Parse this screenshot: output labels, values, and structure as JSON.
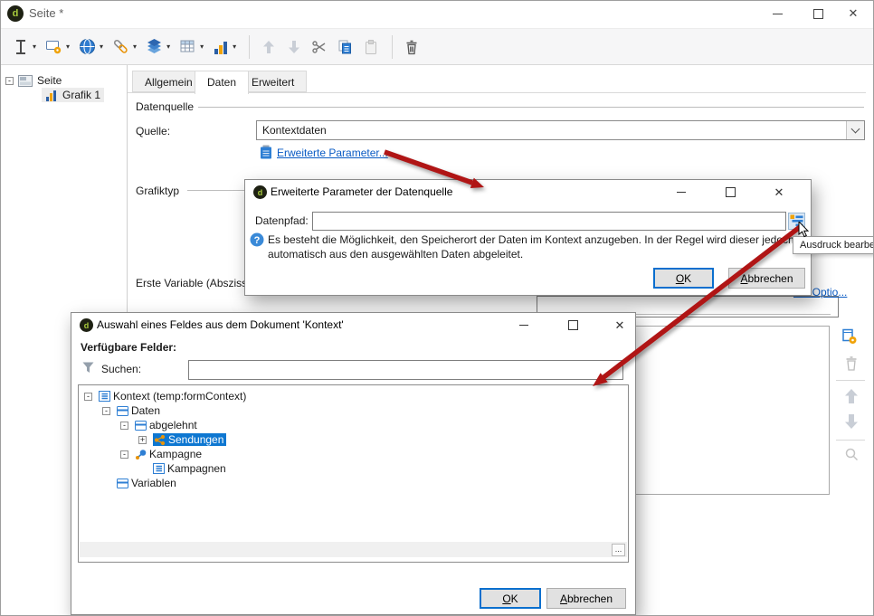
{
  "window": {
    "title": "Seite *"
  },
  "left_tree": {
    "root_label": "Seite",
    "child_label": "Grafik 1"
  },
  "tabs": {
    "allgemein": "Allgemein",
    "daten": "Daten",
    "erweitert": "Erweitert"
  },
  "content": {
    "datenquelle_group": "Datenquelle",
    "quelle_label": "Quelle:",
    "quelle_value": "Kontextdaten",
    "erweiterte_parameter_link": "Erweiterte Parameter...",
    "grafiktyp_group": "Grafiktyp",
    "erste_variable_label": "Erste Variable (Abszisse",
    "weitere_optionen_link_fragment": "ere Optio..."
  },
  "dialog1": {
    "title": "Erweiterte Parameter der Datenquelle",
    "datenpfad_label": "Datenpfad:",
    "datenpfad_value": "",
    "info_text": "Es besteht die Möglichkeit, den Speicherort der Daten im Kontext anzugeben. In der Regel wird dieser jedoch automatisch aus den ausgewählten Daten abgeleitet.",
    "ok_underlined": "O",
    "ok_rest": "K",
    "cancel_underlined": "A",
    "cancel_rest": "bbrechen",
    "tooltip": "Ausdruck bearbeiten"
  },
  "dialog2": {
    "title": "Auswahl eines Feldes aus dem Dokument 'Kontext'",
    "available_fields_label": "Verfügbare Felder:",
    "search_label": "Suchen:",
    "search_value": "",
    "tree": [
      {
        "label": "Kontext (temp:formContext)",
        "exp": "-"
      },
      {
        "label": "Daten",
        "exp": "-"
      },
      {
        "label": "abgelehnt",
        "exp": "-"
      },
      {
        "label": "Sendungen",
        "exp": "+"
      },
      {
        "label": "Kampagne",
        "exp": "-"
      },
      {
        "label": "Kampagnen",
        "exp": ""
      },
      {
        "label": "Variablen",
        "exp": ""
      }
    ],
    "overflow_button": "...",
    "ok_underlined": "O",
    "ok_rest": "K",
    "cancel_underlined": "A",
    "cancel_rest": "bbrechen"
  },
  "colors": {
    "accent_blue": "#0e77d1",
    "link_blue": "#0a5bc4",
    "icon_blue": "#2e7fd4",
    "icon_orange": "#f0a30a",
    "arrow_red": "#b01515"
  }
}
